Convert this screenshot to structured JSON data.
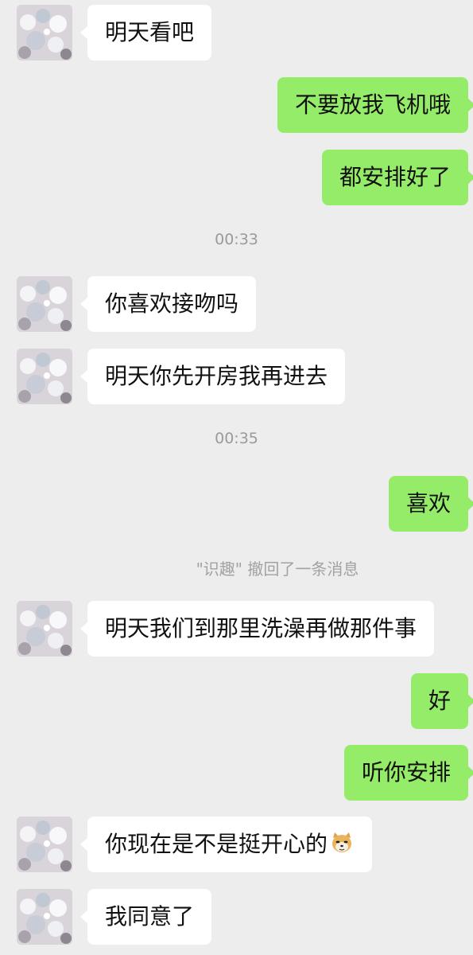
{
  "colors": {
    "background": "#ededed",
    "incoming_bubble": "#ffffff",
    "outgoing_bubble": "#95ec69",
    "text": "#111111",
    "system_text": "#9a9a9a"
  },
  "messages": [
    {
      "kind": "incoming",
      "text": "明天看吧"
    },
    {
      "kind": "outgoing",
      "text": "不要放我飞机哦"
    },
    {
      "kind": "outgoing",
      "text": "都安排好了"
    },
    {
      "kind": "time",
      "text": "00:33"
    },
    {
      "kind": "incoming",
      "text": "你喜欢接吻吗"
    },
    {
      "kind": "incoming",
      "text": "明天你先开房我再进去"
    },
    {
      "kind": "time",
      "text": "00:35"
    },
    {
      "kind": "outgoing",
      "text": "喜欢"
    },
    {
      "kind": "recall",
      "text": "\"识趣\" 撤回了一条消息"
    },
    {
      "kind": "incoming",
      "text": "明天我们到那里洗澡再做那件事"
    },
    {
      "kind": "outgoing",
      "text": "好"
    },
    {
      "kind": "outgoing",
      "text": "听你安排"
    },
    {
      "kind": "incoming",
      "text": "你现在是不是挺开心的",
      "emoji": "doge-emoji-icon"
    },
    {
      "kind": "incoming",
      "text": "我同意了"
    }
  ]
}
